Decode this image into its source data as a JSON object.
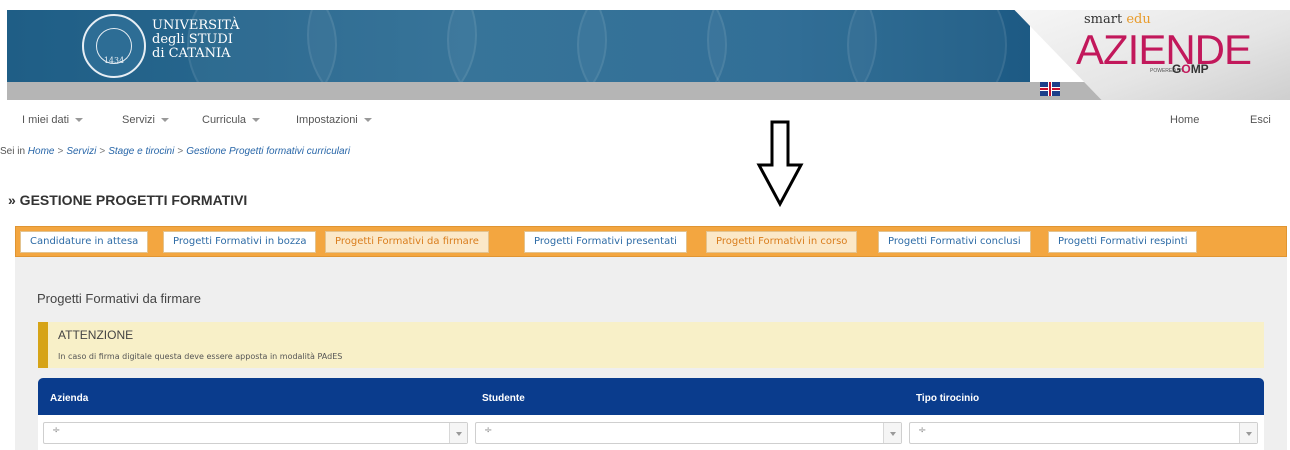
{
  "header": {
    "university_lines": [
      "UNIVERSITÀ",
      "degli STUDI",
      "di CATANIA"
    ],
    "seal_year": "1434",
    "brand_small_1": "smart",
    "brand_small_2": "edu",
    "brand_big": "AZIENDE",
    "brand_powered": "POWERED BY",
    "brand_gomp_1": "G",
    "brand_gomp_2": "O",
    "brand_gomp_3": "MP"
  },
  "nav": {
    "items": [
      {
        "label": "I miei dati"
      },
      {
        "label": "Servizi"
      },
      {
        "label": "Curricula"
      },
      {
        "label": "Impostazioni"
      }
    ],
    "home": "Home",
    "exit": "Esci"
  },
  "breadcrumb": {
    "prefix": "Sei in",
    "items": [
      "Home",
      "Servizi",
      "Stage e tirocini",
      "Gestione Progetti formativi curriculari"
    ],
    "sep": ">"
  },
  "page_title": "» GESTIONE PROGETTI FORMATIVI",
  "tabs": [
    {
      "label": "Candidature in attesa"
    },
    {
      "label": "Progetti Formativi in bozza"
    },
    {
      "label": "Progetti Formativi da firmare"
    },
    {
      "label": "Progetti Formativi presentati"
    },
    {
      "label": "Progetti Formativi in corso"
    },
    {
      "label": "Progetti Formativi conclusi"
    },
    {
      "label": "Progetti Formativi respinti"
    }
  ],
  "section_title": "Progetti Formativi da firmare",
  "alert": {
    "title": "ATTENZIONE",
    "text": "In caso di firma digitale questa deve essere apposta in modalità PAdES"
  },
  "table": {
    "columns": [
      "Azienda",
      "Studente",
      "Tipo tirocinio"
    ],
    "filters": [
      "÷",
      "÷",
      "÷"
    ]
  }
}
